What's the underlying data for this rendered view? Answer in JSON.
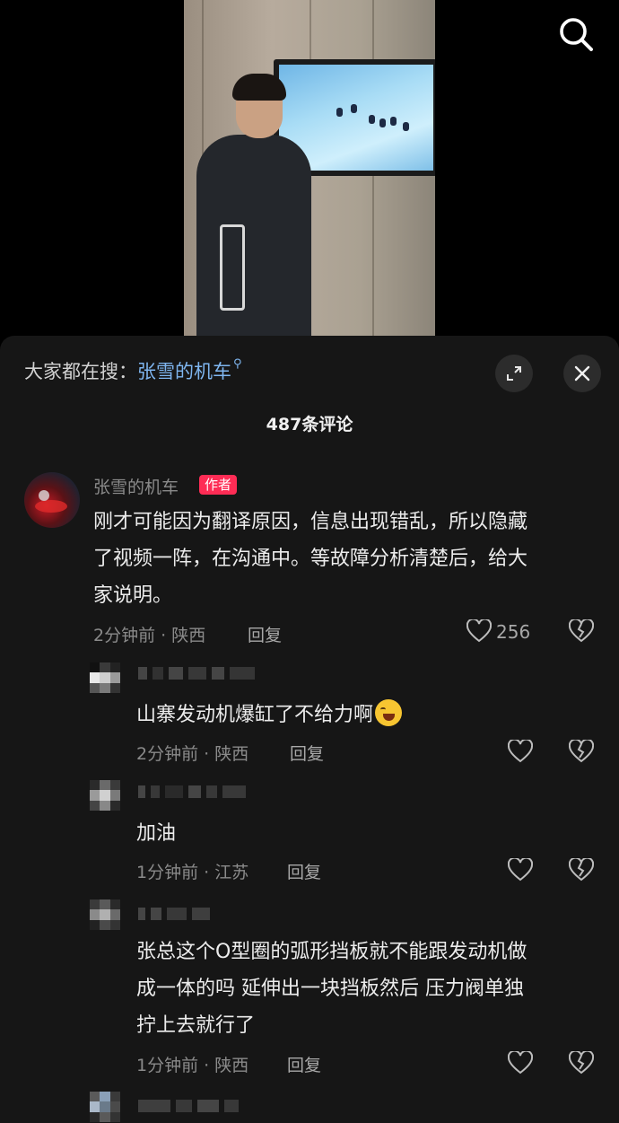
{
  "search_icon": "search-icon",
  "panel": {
    "trending_label": "大家都在搜：",
    "trending_link": "张雪的机车",
    "trending_link_icon": "search-small-icon",
    "expand_icon": "expand-icon",
    "close_icon": "close-icon",
    "comment_count": "487条评论"
  },
  "comments": [
    {
      "author": "张雪的机车",
      "badge": "作者",
      "lines": [
        "刚才可能因为翻译原因，信息出现错乱，所以隐藏",
        "了视频一阵，在沟通中。等故障分析清楚后，给大",
        "家说明。"
      ],
      "meta": "2分钟前 · 陕西",
      "reply": "回复",
      "likes": "256"
    },
    {
      "author": "",
      "text": "山寨发动机爆缸了不给力啊",
      "emoji": "crying-laughing-emoji",
      "meta": "2分钟前 · 陕西",
      "reply": "回复"
    },
    {
      "author": "",
      "text": "加油",
      "meta": "1分钟前 · 江苏",
      "reply": "回复"
    },
    {
      "author": "",
      "lines": [
        "张总这个O型圈的弧形挡板就不能跟发动机做",
        "成一体的吗 延伸出一块挡板然后 压力阀单独",
        "拧上去就行了"
      ],
      "meta": "1分钟前 · 陕西",
      "reply": "回复"
    }
  ],
  "colors": {
    "panel_bg": "#161616",
    "link": "#7fb6f0",
    "author_badge": "#fe2c55"
  }
}
